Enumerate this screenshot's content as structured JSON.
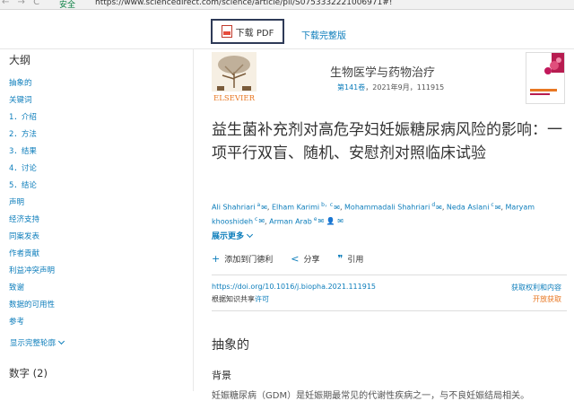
{
  "address_bar": {
    "nav_glyphs": "← → C",
    "secure_label": "安全",
    "url": "https://www.sciencedirect.com/science/article/pii/S0753332221006971#!"
  },
  "toolbar": {
    "download_pdf": "下载 PDF",
    "download_full": "下载完整版"
  },
  "sidebar": {
    "title": "大纲",
    "items": [
      "抽象的",
      "关键词",
      "1．介绍",
      "2．方法",
      "3．结果",
      "4．讨论",
      "5．结论",
      "声明",
      "经济支持",
      "同案发表",
      "作者贡献",
      "利益冲突声明",
      "致谢",
      "数据的可用性",
      "参考"
    ],
    "show_more": "显示完整轮廓",
    "figures": "数字 (2)"
  },
  "journal": {
    "publisher": "ELSEVIER",
    "name": "生物医学与药物治疗",
    "volume_link": "第141卷",
    "volume_rest": "，2021年9月，111915"
  },
  "article": {
    "title": "益生菌补充剂对高危孕妇妊娠糖尿病风险的影响：一项平行双盲、随机、安慰剂对照临床试验",
    "authors": [
      {
        "name": "Ali Shahriari",
        "sup": "a",
        "mark": "✉"
      },
      {
        "name": "Elham Karimi",
        "sup": "b，c",
        "mark": "✉"
      },
      {
        "name": "Mohammadali Shahriari",
        "sup": "d",
        "mark": "✉"
      },
      {
        "name": "Neda Aslani",
        "sup": "c",
        "mark": "✉"
      },
      {
        "name": "Maryam khooshideh",
        "sup": "c",
        "mark": "✉"
      },
      {
        "name": "Arman Arab",
        "sup": "e",
        "mark": "✉ 👤 ✉"
      }
    ],
    "show_more": "展示更多",
    "actions": [
      {
        "icon": "+",
        "label": "添加到门德利"
      },
      {
        "icon": "<",
        "label": "分享"
      },
      {
        "icon": "❞",
        "label": "引用"
      }
    ],
    "doi": "https://doi.org/10.1016/j.biopha.2021.111915",
    "license_prefix": "根据知识共享",
    "license_link": "许可",
    "rights": "获取权利和内容",
    "open_access": "开放获取",
    "abstract_heading": "抽象的",
    "background_heading": "背景",
    "background_text": "妊娠糖尿病（GDM）是妊娠期最常见的代谢性疾病之一，与不良妊娠结局相关。"
  }
}
